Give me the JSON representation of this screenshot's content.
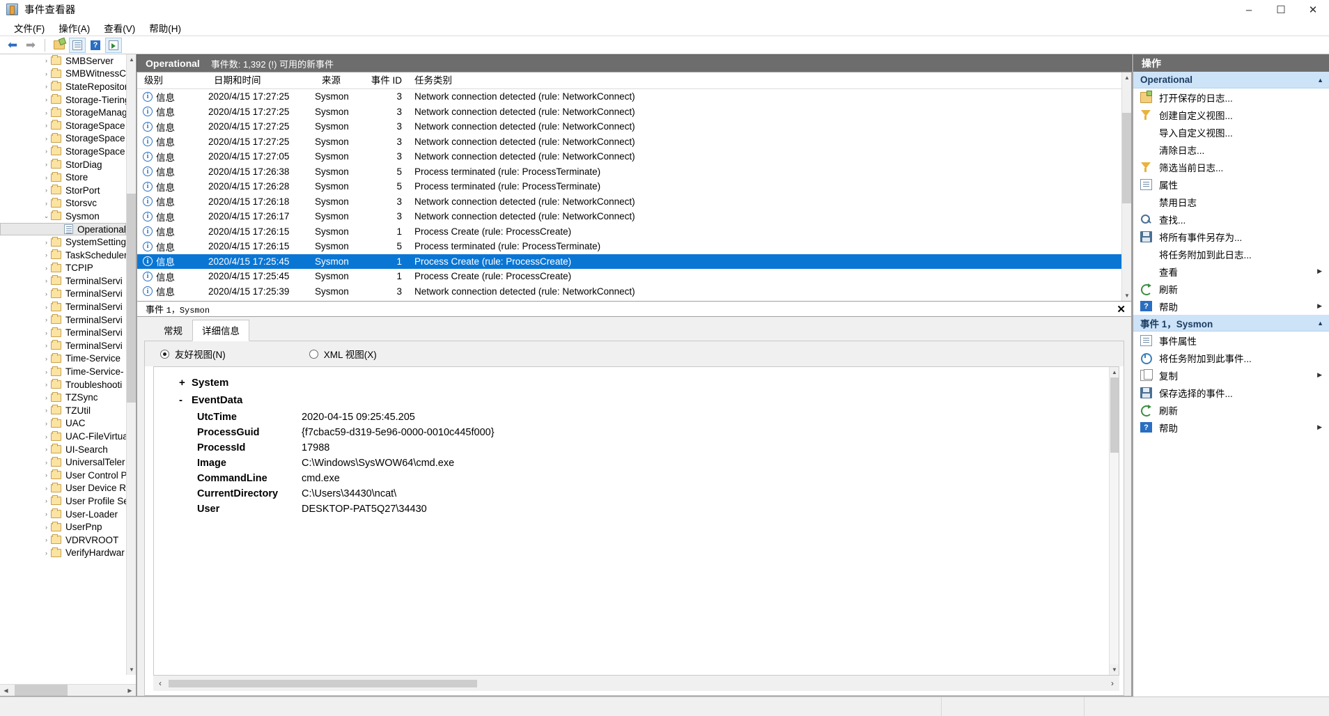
{
  "window": {
    "title": "事件查看器",
    "icon": "event-viewer-icon",
    "minimize": "–",
    "maximize": "☐",
    "close": "✕"
  },
  "menu": [
    {
      "label": "文件(F)"
    },
    {
      "label": "操作(A)"
    },
    {
      "label": "查看(V)"
    },
    {
      "label": "帮助(H)"
    }
  ],
  "toolbar": {
    "back": "←",
    "forward": "→",
    "open_folder": "open-folder-icon",
    "show_list": "show-list-icon",
    "help": "?",
    "run": "run-icon"
  },
  "tree": {
    "items": [
      {
        "label": "SMBServer",
        "type": "folder",
        "expanded": false,
        "indent": 1
      },
      {
        "label": "SMBWitnessC",
        "type": "folder",
        "expanded": false,
        "indent": 1
      },
      {
        "label": "StateRepositor",
        "type": "folder",
        "expanded": false,
        "indent": 1
      },
      {
        "label": "Storage-Tiering",
        "type": "folder",
        "expanded": false,
        "indent": 1
      },
      {
        "label": "StorageManag",
        "type": "folder",
        "expanded": false,
        "indent": 1
      },
      {
        "label": "StorageSpace",
        "type": "folder",
        "expanded": false,
        "indent": 1
      },
      {
        "label": "StorageSpace",
        "type": "folder",
        "expanded": false,
        "indent": 1
      },
      {
        "label": "StorageSpace",
        "type": "folder",
        "expanded": false,
        "indent": 1
      },
      {
        "label": "StorDiag",
        "type": "folder",
        "expanded": false,
        "indent": 1
      },
      {
        "label": "Store",
        "type": "folder",
        "expanded": false,
        "indent": 1
      },
      {
        "label": "StorPort",
        "type": "folder",
        "expanded": false,
        "indent": 1
      },
      {
        "label": "Storsvc",
        "type": "folder",
        "expanded": false,
        "indent": 1
      },
      {
        "label": "Sysmon",
        "type": "folder",
        "expanded": true,
        "indent": 1
      },
      {
        "label": "Operational",
        "type": "log",
        "selected": true,
        "indent": 2
      },
      {
        "label": "SystemSetting",
        "type": "folder",
        "expanded": false,
        "indent": 1
      },
      {
        "label": "TaskScheduler",
        "type": "folder",
        "expanded": false,
        "indent": 1
      },
      {
        "label": "TCPIP",
        "type": "folder",
        "expanded": false,
        "indent": 1
      },
      {
        "label": "TerminalServi",
        "type": "folder",
        "expanded": false,
        "indent": 1
      },
      {
        "label": "TerminalServi",
        "type": "folder",
        "expanded": false,
        "indent": 1
      },
      {
        "label": "TerminalServi",
        "type": "folder",
        "expanded": false,
        "indent": 1
      },
      {
        "label": "TerminalServi",
        "type": "folder",
        "expanded": false,
        "indent": 1
      },
      {
        "label": "TerminalServi",
        "type": "folder",
        "expanded": false,
        "indent": 1
      },
      {
        "label": "TerminalServi",
        "type": "folder",
        "expanded": false,
        "indent": 1
      },
      {
        "label": "Time-Service",
        "type": "folder",
        "expanded": false,
        "indent": 1
      },
      {
        "label": "Time-Service-",
        "type": "folder",
        "expanded": false,
        "indent": 1
      },
      {
        "label": "Troubleshooti",
        "type": "folder",
        "expanded": false,
        "indent": 1
      },
      {
        "label": "TZSync",
        "type": "folder",
        "expanded": false,
        "indent": 1
      },
      {
        "label": "TZUtil",
        "type": "folder",
        "expanded": false,
        "indent": 1
      },
      {
        "label": "UAC",
        "type": "folder",
        "expanded": false,
        "indent": 1
      },
      {
        "label": "UAC-FileVirtua",
        "type": "folder",
        "expanded": false,
        "indent": 1
      },
      {
        "label": "UI-Search",
        "type": "folder",
        "expanded": false,
        "indent": 1
      },
      {
        "label": "UniversalTeler",
        "type": "folder",
        "expanded": false,
        "indent": 1
      },
      {
        "label": "User Control P",
        "type": "folder",
        "expanded": false,
        "indent": 1
      },
      {
        "label": "User Device R",
        "type": "folder",
        "expanded": false,
        "indent": 1
      },
      {
        "label": "User Profile Se",
        "type": "folder",
        "expanded": false,
        "indent": 1
      },
      {
        "label": "User-Loader",
        "type": "folder",
        "expanded": false,
        "indent": 1
      },
      {
        "label": "UserPnp",
        "type": "folder",
        "expanded": false,
        "indent": 1
      },
      {
        "label": "VDRVROOT",
        "type": "folder",
        "expanded": false,
        "indent": 1
      },
      {
        "label": "VerifyHardwar",
        "type": "folder",
        "expanded": false,
        "indent": 1
      }
    ]
  },
  "event_list": {
    "header_title": "Operational",
    "header_sub": "事件数: 1,392 (!) 可用的新事件",
    "columns": [
      "级别",
      "日期和时间",
      "来源",
      "事件 ID",
      "任务类别"
    ],
    "rows": [
      {
        "level": "信息",
        "date": "2020/4/15 17:27:25",
        "source": "Sysmon",
        "eid": "3",
        "task": "Network connection detected (rule: NetworkConnect)",
        "selected": false
      },
      {
        "level": "信息",
        "date": "2020/4/15 17:27:25",
        "source": "Sysmon",
        "eid": "3",
        "task": "Network connection detected (rule: NetworkConnect)",
        "selected": false
      },
      {
        "level": "信息",
        "date": "2020/4/15 17:27:25",
        "source": "Sysmon",
        "eid": "3",
        "task": "Network connection detected (rule: NetworkConnect)",
        "selected": false
      },
      {
        "level": "信息",
        "date": "2020/4/15 17:27:25",
        "source": "Sysmon",
        "eid": "3",
        "task": "Network connection detected (rule: NetworkConnect)",
        "selected": false
      },
      {
        "level": "信息",
        "date": "2020/4/15 17:27:05",
        "source": "Sysmon",
        "eid": "3",
        "task": "Network connection detected (rule: NetworkConnect)",
        "selected": false
      },
      {
        "level": "信息",
        "date": "2020/4/15 17:26:38",
        "source": "Sysmon",
        "eid": "5",
        "task": "Process terminated (rule: ProcessTerminate)",
        "selected": false
      },
      {
        "level": "信息",
        "date": "2020/4/15 17:26:28",
        "source": "Sysmon",
        "eid": "5",
        "task": "Process terminated (rule: ProcessTerminate)",
        "selected": false
      },
      {
        "level": "信息",
        "date": "2020/4/15 17:26:18",
        "source": "Sysmon",
        "eid": "3",
        "task": "Network connection detected (rule: NetworkConnect)",
        "selected": false
      },
      {
        "level": "信息",
        "date": "2020/4/15 17:26:17",
        "source": "Sysmon",
        "eid": "3",
        "task": "Network connection detected (rule: NetworkConnect)",
        "selected": false
      },
      {
        "level": "信息",
        "date": "2020/4/15 17:26:15",
        "source": "Sysmon",
        "eid": "1",
        "task": "Process Create (rule: ProcessCreate)",
        "selected": false
      },
      {
        "level": "信息",
        "date": "2020/4/15 17:26:15",
        "source": "Sysmon",
        "eid": "5",
        "task": "Process terminated (rule: ProcessTerminate)",
        "selected": false
      },
      {
        "level": "信息",
        "date": "2020/4/15 17:25:45",
        "source": "Sysmon",
        "eid": "1",
        "task": "Process Create (rule: ProcessCreate)",
        "selected": true
      },
      {
        "level": "信息",
        "date": "2020/4/15 17:25:45",
        "source": "Sysmon",
        "eid": "1",
        "task": "Process Create (rule: ProcessCreate)",
        "selected": false
      },
      {
        "level": "信息",
        "date": "2020/4/15 17:25:39",
        "source": "Sysmon",
        "eid": "3",
        "task": "Network connection detected (rule: NetworkConnect)",
        "selected": false
      }
    ]
  },
  "detail": {
    "header": "事件 1，Sysmon",
    "header_prefix": "事件 ",
    "header_mono": "1，Sysmon",
    "close": "✕",
    "tabs": [
      {
        "label": "常规",
        "active": false
      },
      {
        "label": "详细信息",
        "active": true
      }
    ],
    "view_modes": [
      {
        "label": "友好视图(N)",
        "selected": true
      },
      {
        "label": "XML 视图(X)",
        "selected": false
      }
    ],
    "nodes": [
      {
        "sign": "+",
        "label": "System"
      },
      {
        "sign": "-",
        "label": "EventData"
      }
    ],
    "fields": [
      {
        "key": "UtcTime",
        "value": "2020-04-15 09:25:45.205"
      },
      {
        "key": "ProcessGuid",
        "value": "{f7cbac59-d319-5e96-0000-0010c445f000}"
      },
      {
        "key": "ProcessId",
        "value": "17988"
      },
      {
        "key": "Image",
        "value": "C:\\Windows\\SysWOW64\\cmd.exe"
      },
      {
        "key": "CommandLine",
        "value": "cmd.exe"
      },
      {
        "key": "CurrentDirectory",
        "value": "C:\\Users\\34430\\ncat\\"
      },
      {
        "key": "User",
        "value": "DESKTOP-PAT5Q27\\34430"
      }
    ],
    "scroll_left": "‹",
    "scroll_right": "›"
  },
  "actions": {
    "title": "操作",
    "groups": [
      {
        "title": "Operational",
        "collapse": "▲",
        "items": [
          {
            "label": "打开保存的日志...",
            "icon": "open-log-icon",
            "submenu": false
          },
          {
            "label": "创建自定义视图...",
            "icon": "filter-icon",
            "submenu": false
          },
          {
            "label": "导入自定义视图...",
            "icon": "none",
            "submenu": false
          },
          {
            "label": "清除日志...",
            "icon": "none",
            "submenu": false
          },
          {
            "label": "筛选当前日志...",
            "icon": "filter-icon",
            "submenu": false
          },
          {
            "label": "属性",
            "icon": "properties-icon",
            "submenu": false
          },
          {
            "label": "禁用日志",
            "icon": "none",
            "submenu": false
          },
          {
            "label": "查找...",
            "icon": "find-icon",
            "submenu": false
          },
          {
            "label": "将所有事件另存为...",
            "icon": "save-icon",
            "submenu": false
          },
          {
            "label": "将任务附加到此日志...",
            "icon": "none",
            "submenu": false
          },
          {
            "label": "查看",
            "icon": "none",
            "submenu": true
          },
          {
            "label": "刷新",
            "icon": "refresh-icon",
            "submenu": false
          },
          {
            "label": "帮助",
            "icon": "help-icon",
            "submenu": true
          }
        ]
      },
      {
        "title": "事件 1，Sysmon",
        "collapse": "▲",
        "items": [
          {
            "label": "事件属性",
            "icon": "event-properties-icon",
            "submenu": false
          },
          {
            "label": "将任务附加到此事件...",
            "icon": "attach-task-icon",
            "submenu": false
          },
          {
            "label": "复制",
            "icon": "copy-icon",
            "submenu": true
          },
          {
            "label": "保存选择的事件...",
            "icon": "save-icon",
            "submenu": false
          },
          {
            "label": "刷新",
            "icon": "refresh-icon",
            "submenu": false
          },
          {
            "label": "帮助",
            "icon": "help-icon",
            "submenu": true
          }
        ]
      }
    ],
    "submenu_arrow": "▶"
  }
}
